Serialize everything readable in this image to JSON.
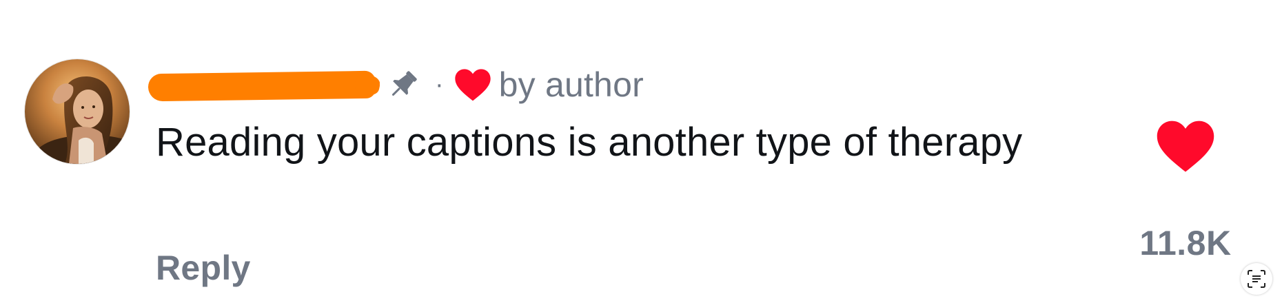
{
  "comment": {
    "avatar_icon": "user-avatar",
    "username": "",
    "username_redacted": true,
    "pinned_icon": "pin-icon",
    "separator": "·",
    "author_heart_icon": "heart-icon",
    "liked_by_author_text": "by author",
    "text": "Reading your captions is another type of therapy",
    "reply_label": "Reply",
    "like_icon": "heart-icon",
    "like_count": "11.8K"
  },
  "colors": {
    "heart": "#ff0a2b",
    "redaction": "#ff7f00",
    "secondary_text": "#6f7784",
    "primary_text": "#111418"
  },
  "overlay": {
    "scan_icon": "live-text-scan-icon"
  }
}
